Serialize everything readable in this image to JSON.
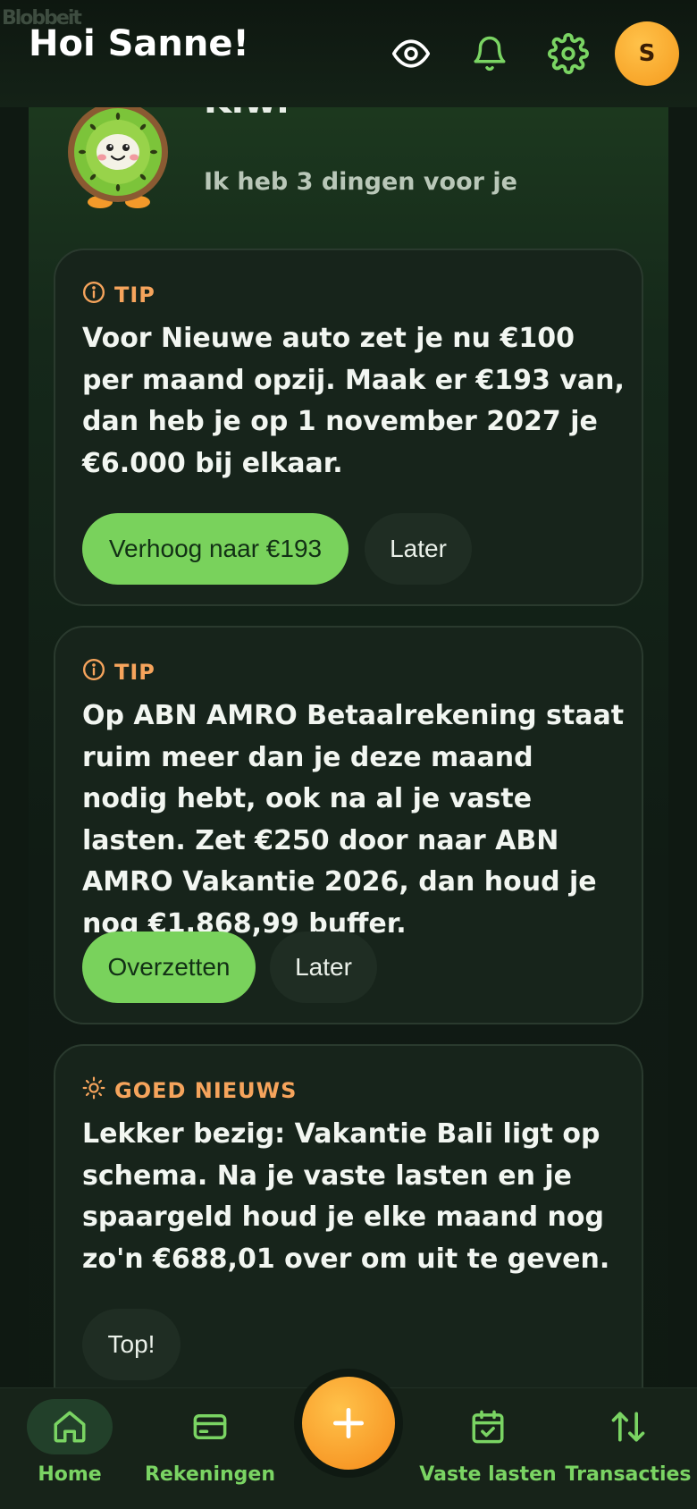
{
  "header": {
    "greeting": "Hoi Sanne!",
    "avatar_initial": "S",
    "icons": [
      "eye-icon",
      "bell-icon",
      "gear-icon"
    ],
    "ghost_text": "Blobbeit"
  },
  "kiwi": {
    "name": "Kiwi",
    "subtitle": "Ik heb 3 dingen voor je"
  },
  "cards": [
    {
      "tag": "TIP",
      "icon": "info-icon",
      "text": "Voor Nieuwe auto zet je nu €100 per maand opzij. Maak er €193 van, dan heb je op 1 november 2027 je €6.000 bij elkaar.",
      "primary": "Verhoog naar €193",
      "secondary": "Later"
    },
    {
      "tag": "TIP",
      "icon": "info-icon",
      "text": "Op ABN AMRO Betaalrekening staat ruim meer dan je deze maand nodig hebt, ook na al je vaste lasten. Zet €250 door naar ABN AMRO Vakantie 2026, dan houd je nog €1.868,99 buffer.",
      "primary": "Overzetten",
      "secondary": "Later"
    },
    {
      "tag": "GOED NIEUWS",
      "icon": "sun-icon",
      "text": "Lekker bezig: Vakantie Bali ligt op schema. Na je vaste lasten en je spaargeld houd je elke maand nog zo'n €688,01 over om uit te geven.",
      "secondary": "Top!"
    }
  ],
  "nav": {
    "items": [
      {
        "label": "Home",
        "icon": "home-icon"
      },
      {
        "label": "Rekeningen",
        "icon": "card-icon"
      },
      {
        "label": "Vaste lasten",
        "icon": "calendar-check-icon"
      },
      {
        "label": "Transacties",
        "icon": "arrows-up-down-icon"
      }
    ],
    "active": "Home",
    "fab_icon": "plus-icon"
  },
  "colors": {
    "accent_green": "#79d25c",
    "accent_orange": "#f6a45c",
    "fab_orange": "#f58a1a",
    "background": "#0f1912",
    "card": "#17241b"
  }
}
